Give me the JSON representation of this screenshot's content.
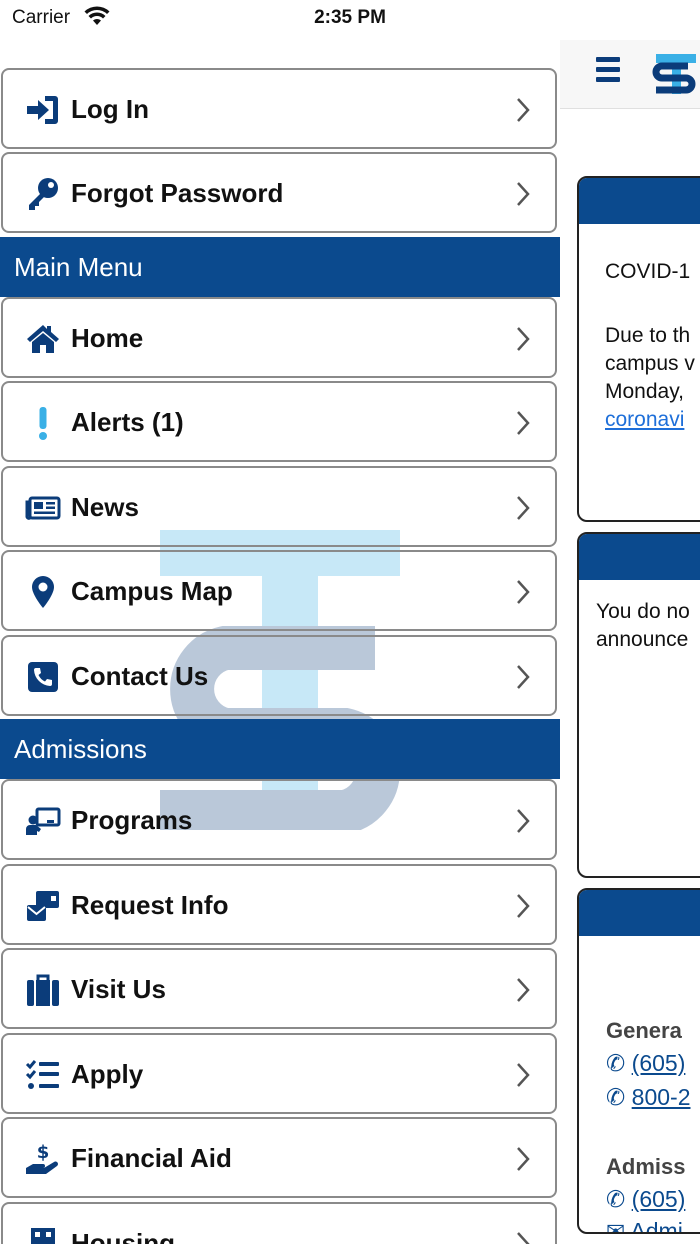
{
  "status_bar": {
    "carrier": "Carrier",
    "time": "2:35 PM"
  },
  "background_page": {
    "card1_line1": "COVID-1",
    "card1_line2": "Due to th",
    "card1_line3": "campus v",
    "card1_line4": "Monday,",
    "card1_link": "coronavi",
    "card2_line1": "You do no",
    "card2_line2": "announce",
    "card3_heading1": "Genera",
    "card3_phone1": "(605)",
    "card3_phone2": "800-2",
    "card3_heading2": "Admiss",
    "card3_phone3": "(605)",
    "card3_email": "Admi"
  },
  "drawer": {
    "top_items": [
      {
        "label": "Log In",
        "icon": "sign-in-icon"
      },
      {
        "label": "Forgot Password",
        "icon": "key-icon"
      }
    ],
    "main_menu": {
      "title": "Main Menu",
      "items": [
        {
          "label": "Home",
          "icon": "home-icon"
        },
        {
          "label": "Alerts (1)",
          "icon": "exclamation-icon"
        },
        {
          "label": "News",
          "icon": "newspaper-icon"
        },
        {
          "label": "Campus Map",
          "icon": "map-marker-icon"
        },
        {
          "label": "Contact Us",
          "icon": "phone-icon"
        }
      ]
    },
    "admissions": {
      "title": "Admissions",
      "items": [
        {
          "label": "Programs",
          "icon": "teacher-board-icon"
        },
        {
          "label": "Request Info",
          "icon": "mail-bulk-icon"
        },
        {
          "label": "Visit Us",
          "icon": "suitcase-icon"
        },
        {
          "label": "Apply",
          "icon": "tasks-list-icon"
        },
        {
          "label": "Financial Aid",
          "icon": "hand-holding-dollar-icon"
        },
        {
          "label": "Housing",
          "icon": "building-icon"
        }
      ]
    }
  },
  "colors": {
    "primary": "#0b4a8e",
    "accent": "#3ab0e6",
    "link": "#1e6fd9"
  }
}
